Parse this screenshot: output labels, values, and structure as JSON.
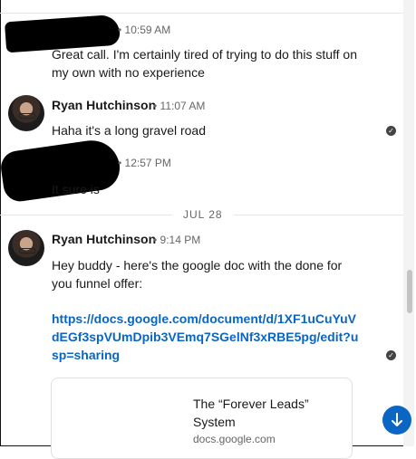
{
  "messages": [
    {
      "time": "• 10:59 AM",
      "text": "Great call. I'm certainly tired of trying to do this stuff on my own with no experience"
    },
    {
      "name": "Ryan Hutchinson",
      "time": "• 11:07 AM",
      "text": "Haha it's a long gravel road"
    },
    {
      "time": "• 12:57 PM",
      "text": "It sure is"
    }
  ],
  "date_separator": "JUL 28",
  "last_message": {
    "name": "Ryan Hutchinson",
    "time": "• 9:14 PM",
    "text": "Hey buddy - here's the google doc with the done for you funnel offer:",
    "link": "https://docs.google.com/document/d/1XF1uCuYuVdEGf3spVUmDpib3VEmq7SGelNf3xRBE5pg/edit?usp=sharing"
  },
  "link_preview": {
    "title": "The “Forever Leads” System",
    "domain": "docs.google.com"
  },
  "icons": {
    "read_receipt": "check-circle-icon",
    "scroll_down": "arrow-down-icon"
  },
  "colors": {
    "accent": "#0a66c2",
    "text": "#191919",
    "muted": "#666666"
  }
}
